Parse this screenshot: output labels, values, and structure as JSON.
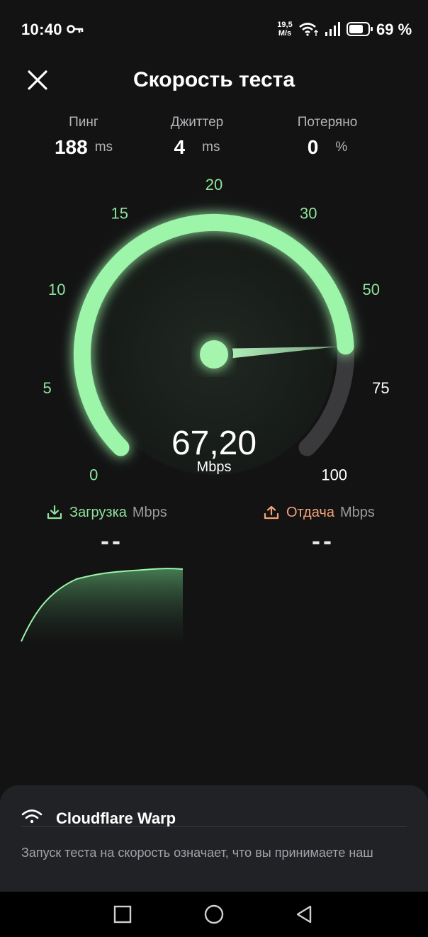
{
  "status_bar": {
    "time": "10:40",
    "net_speed_value": "19,5",
    "net_speed_unit": "M/s",
    "battery_percent": "69 %",
    "icons": [
      "key-icon",
      "wifi-icon",
      "signal-icon",
      "battery-icon"
    ]
  },
  "header": {
    "title": "Скорость теста",
    "close_icon": "close-icon"
  },
  "metrics": {
    "ping": {
      "label": "Пинг",
      "value": "188",
      "unit": "ms"
    },
    "jitter": {
      "label": "Джиттер",
      "value": "4",
      "unit": "ms"
    },
    "lost": {
      "label": "Потеряно",
      "value": "0",
      "unit": "%"
    }
  },
  "gauge": {
    "ticks": [
      "0",
      "5",
      "10",
      "15",
      "20",
      "30",
      "50",
      "75",
      "100"
    ],
    "ticks_active": [
      "0",
      "5",
      "10",
      "15",
      "20",
      "30",
      "50"
    ],
    "ticks_inactive": [
      "75",
      "100"
    ],
    "speed": "67,20",
    "unit": "Mbps",
    "progress_fraction": 0.82,
    "accent_color": "#9cf5a8",
    "track_color": "#3a3a3c"
  },
  "download": {
    "label": "Загрузка",
    "unit": "Mbps",
    "value": "--",
    "color": "#8ee49b",
    "icon": "download-icon"
  },
  "upload": {
    "label": "Отдача",
    "unit": "Mbps",
    "value": "--",
    "color": "#f4a278",
    "icon": "upload-icon"
  },
  "bottom_sheet": {
    "network_name": "Cloudflare Warp",
    "network_icon": "wifi-icon",
    "disclaimer": "Запуск теста на скорость означает, что вы принимаете наш"
  },
  "nav_bar": {
    "icons": [
      "square-icon",
      "circle-icon",
      "triangle-back-icon"
    ]
  }
}
